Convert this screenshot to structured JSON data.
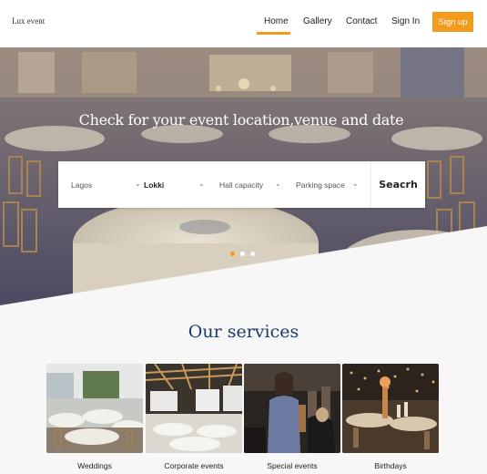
{
  "nav": {
    "logo": "Lux event",
    "links": [
      "Home",
      "Gallery",
      "Contact",
      "Sign In"
    ],
    "active": "Home",
    "signup": "Sign up",
    "accent_color": "#f39b1c"
  },
  "hero": {
    "title": "Check for your event location,venue and date",
    "slider_pages": 3,
    "active_slide": 1
  },
  "search": {
    "location": "Lagos",
    "venue": "Lokki",
    "capacity": "Hall capacity",
    "parking": "Parking space",
    "button": "Seacrh",
    "chevron_icon": "chevron-down-icon"
  },
  "services": {
    "title": "Our services",
    "title_color": "#1d3b66",
    "items": [
      {
        "label": "Weddings"
      },
      {
        "label": "Corporate events"
      },
      {
        "label": "Special events"
      },
      {
        "label": "Birthdays"
      }
    ]
  }
}
